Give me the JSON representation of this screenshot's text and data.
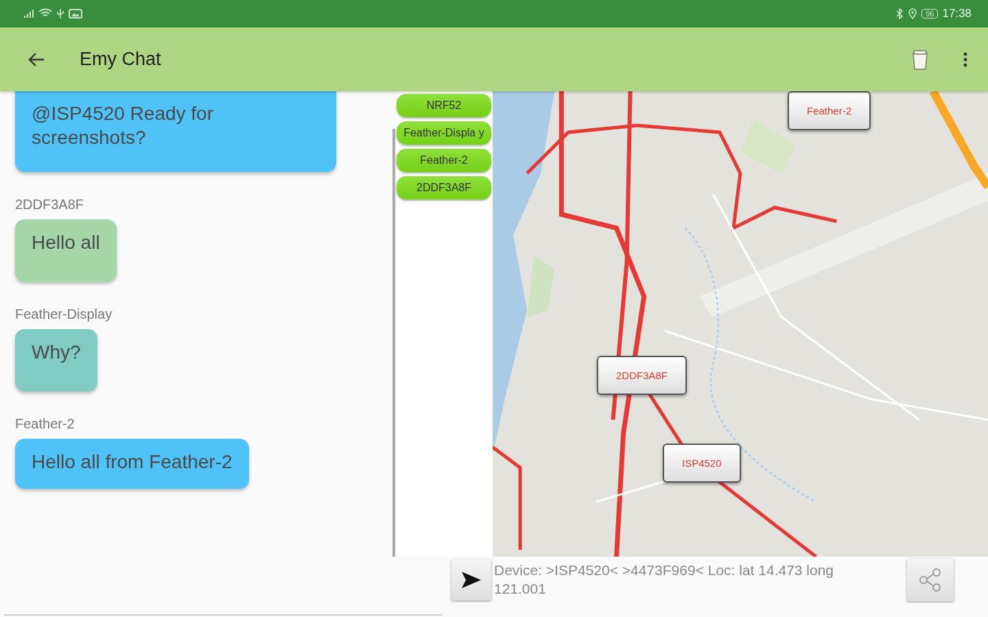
{
  "status_bar": {
    "battery": "96",
    "time": "17:38"
  },
  "app_bar": {
    "title": "Emy Chat"
  },
  "messages": [
    {
      "text": "@ISP4520 Ready for screenshots?",
      "color": "#4fc3f7"
    },
    {
      "sender": "2DDF3A8F",
      "text": "Hello all",
      "color": "#a5d6a7"
    },
    {
      "sender": "Feather-Display",
      "text": "Why?",
      "color": "#80cbc4"
    },
    {
      "sender": "Feather-2",
      "text": "Hello all from Feather-2",
      "color": "#4fc3f7"
    }
  ],
  "devices": [
    "NRF52",
    "Feather-Displa y",
    "Feather-2",
    "2DDF3A8F"
  ],
  "map": {
    "markers": [
      "Feather-2",
      "2DDF3A8F",
      "ISP4520"
    ]
  },
  "device_info": "Device: >ISP4520< >4473F969< Loc: lat 14.473 long 121.001"
}
